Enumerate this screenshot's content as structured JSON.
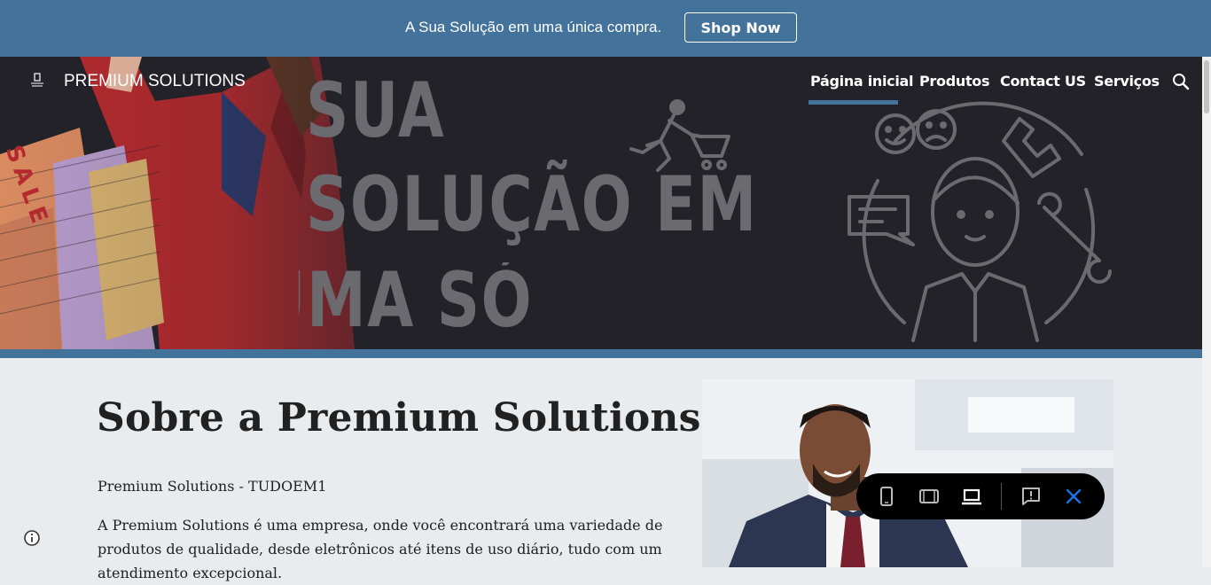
{
  "announcement": {
    "text": "A Sua Solução em uma única compra.",
    "button_label": "Shop Now"
  },
  "header": {
    "site_title": "PREMIUM SOLUTIONS",
    "nav": [
      {
        "label": "Página inicial",
        "active": true
      },
      {
        "label": "Produtos",
        "active": false
      },
      {
        "label": "Contact US",
        "active": false
      },
      {
        "label": "Serviços",
        "active": false
      }
    ]
  },
  "hero": {
    "line1": "SUA",
    "line2": "SOLUÇÃO EM",
    "line3": "UMA SÓ",
    "bag_text": "SALE"
  },
  "main": {
    "heading": "Sobre a Premium Solutions",
    "subheading": "Premium Solutions - TUDOEM1",
    "paragraph": "A Premium Solutions é uma empresa, onde você encontrará uma variedade de produtos de qualidade, desde eletrônicos até itens de uso diário, tudo com um atendimento excepcional."
  },
  "preview_toolbar": {
    "icons": [
      "phone-preview-icon",
      "tablet-preview-icon",
      "laptop-preview-icon",
      "report-icon",
      "close-icon"
    ]
  },
  "colors": {
    "accent": "#43729a",
    "hero_background": "#232228",
    "page_background": "#e8ecee",
    "toolbar_background": "#000000",
    "close_icon": "#1a73e8"
  }
}
